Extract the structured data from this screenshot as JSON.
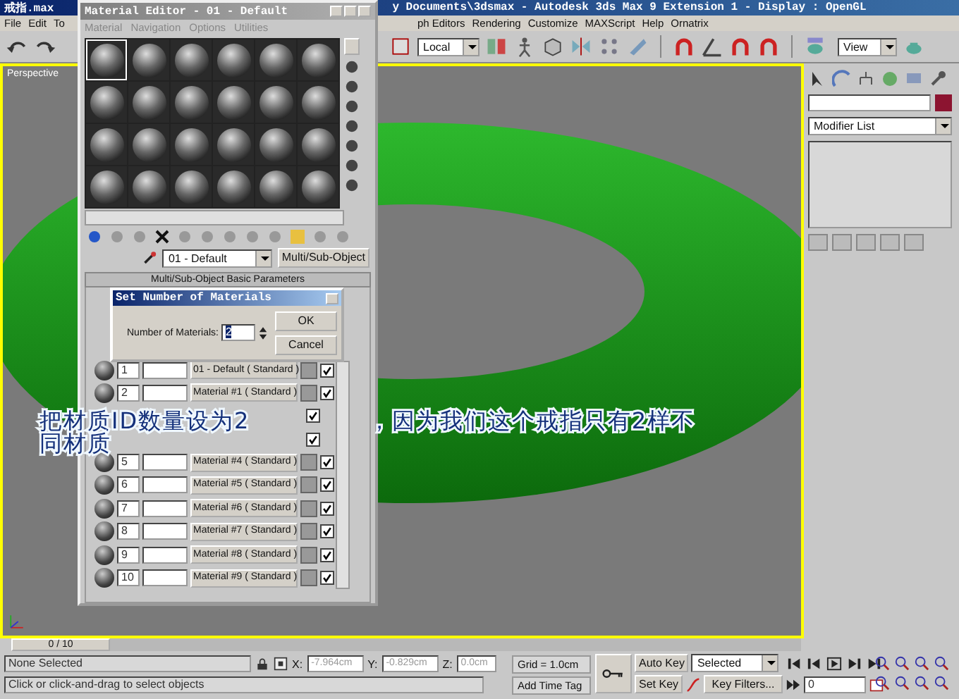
{
  "app_window": {
    "title": "戒指.max",
    "title_tail": "y Documents\\3dsmax   - Autodesk 3ds Max 9 Extension 1   - Display : OpenGL"
  },
  "menu_left": [
    "File",
    "Edit",
    "To"
  ],
  "menu_right": [
    "ph Editors",
    "Rendering",
    "Customize",
    "MAXScript",
    "Help",
    "Ornatrix"
  ],
  "toolbar": {
    "reference_coord": "Local",
    "view_dropdown": "View"
  },
  "viewport": {
    "label": "Perspective"
  },
  "time_slider": {
    "position": "0 / 10",
    "level": 0
  },
  "command_panel": {
    "modifier_list": "Modifier List"
  },
  "material_editor": {
    "title": "Material Editor - 01 - Default",
    "menu": [
      "Material",
      "Navigation",
      "Options",
      "Utilities"
    ],
    "slots": [
      {
        "selected": true
      },
      {
        "selected": false
      },
      {
        "selected": false
      },
      {
        "selected": false
      },
      {
        "selected": false
      },
      {
        "selected": false
      },
      {
        "selected": false
      },
      {
        "selected": false
      },
      {
        "selected": false
      },
      {
        "selected": false
      },
      {
        "selected": false
      },
      {
        "selected": false
      },
      {
        "selected": false
      },
      {
        "selected": false
      },
      {
        "selected": false
      },
      {
        "selected": false
      },
      {
        "selected": false
      },
      {
        "selected": false
      },
      {
        "selected": false
      },
      {
        "selected": false
      },
      {
        "selected": false
      },
      {
        "selected": false
      },
      {
        "selected": false
      },
      {
        "selected": false
      }
    ],
    "material_name": "01 - Default",
    "material_type": "Multi/Sub-Object",
    "rollout_title": "Multi/Sub-Object Basic Parameters",
    "rows": [
      {
        "id": "1",
        "material": "01 - Default  ( Standard )",
        "on": true
      },
      {
        "id": "2",
        "material": "Material #1  ( Standard )",
        "on": true
      },
      {
        "on": true
      },
      {
        "on": true
      },
      {
        "id": "5",
        "material": "Material #4  ( Standard )",
        "on": true
      },
      {
        "id": "6",
        "material": "Material #5  ( Standard )",
        "on": true
      },
      {
        "id": "7",
        "material": "Material #6  ( Standard )",
        "on": true
      },
      {
        "id": "8",
        "material": "Material #7  ( Standard )",
        "on": true
      },
      {
        "id": "9",
        "material": "Material #8  ( Standard )",
        "on": true
      },
      {
        "id": "10",
        "material": "Material #9  ( Standard )",
        "on": true
      }
    ]
  },
  "dialog": {
    "title": "Set Number of Materials",
    "label": "Number of Materials:",
    "value": "2",
    "buttons": [
      "OK",
      "Cancel"
    ]
  },
  "caption": [
    [
      "把材质ID数量设为2",
      "，因为我们这个戒指只有2样不"
    ],
    [
      "同材质"
    ]
  ],
  "status_bar": {
    "selection": "None Selected",
    "x_label": "X:",
    "x": "-7.964cm",
    "y_label": "Y:",
    "y": "-0.829cm",
    "z_label": "Z:",
    "z": "0.0cm",
    "grid": "Grid = 1.0cm",
    "prompt": "Click or click-and-drag to select objects",
    "time_tag": "Add Time Tag",
    "auto_key": "Auto Key",
    "key_mode": "Selected",
    "set_key": "Set Key",
    "key_filters": "Key Filters...",
    "frame": "0"
  }
}
